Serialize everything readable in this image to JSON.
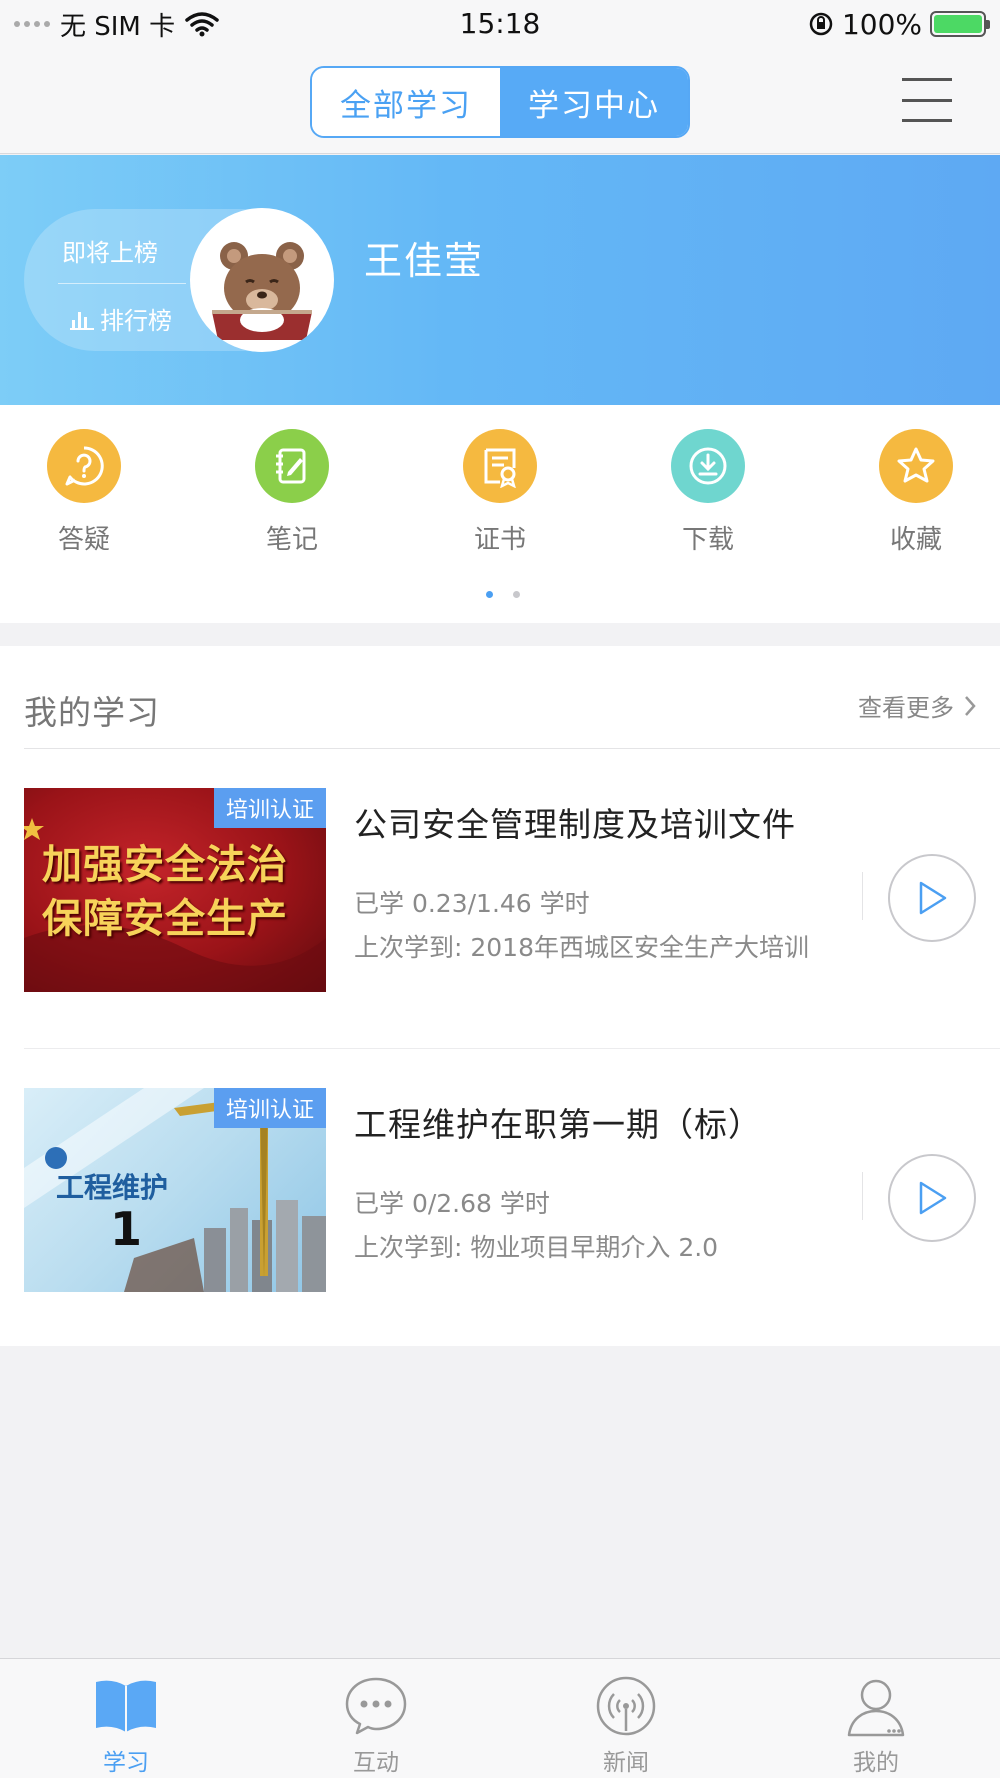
{
  "status_bar": {
    "carrier": "无 SIM 卡",
    "time": "15:18",
    "battery": "100%"
  },
  "header": {
    "tabs": [
      {
        "label": "全部学习",
        "active": false
      },
      {
        "label": "学习中心",
        "active": true
      }
    ],
    "accent": "#57aaf6"
  },
  "profile": {
    "rank_status": "即将上榜",
    "rank_link": "排行榜",
    "name": "王佳莹"
  },
  "quick_actions": [
    {
      "label": "答疑",
      "icon": "question-icon",
      "color": "#f5b940"
    },
    {
      "label": "笔记",
      "icon": "notebook-icon",
      "color": "#8bcf4a"
    },
    {
      "label": "证书",
      "icon": "certificate-icon",
      "color": "#f5b940"
    },
    {
      "label": "下载",
      "icon": "download-icon",
      "color": "#6fd6cf"
    },
    {
      "label": "收藏",
      "icon": "star-icon",
      "color": "#f5b940"
    }
  ],
  "pager": {
    "pages": 2,
    "current": 1
  },
  "my_learning": {
    "title": "我的学习",
    "more_label": "查看更多",
    "courses": [
      {
        "tag": "培训认证",
        "thumb_text_1": "加强安全法治",
        "thumb_text_2": "保障安全生产",
        "title": "公司安全管理制度及培训文件",
        "progress": "已学 0.23/1.46 学时",
        "last": "上次学到: 2018年西城区安全生产大培训"
      },
      {
        "tag": "培训认证",
        "thumb_text_1": "工程维护",
        "thumb_text_2": "1",
        "title": "工程维护在职第一期（标）",
        "progress": "已学 0/2.68 学时",
        "last": "上次学到: 物业项目早期介入 2.0"
      }
    ]
  },
  "tab_bar": [
    {
      "label": "学习",
      "icon": "book-icon",
      "active": true
    },
    {
      "label": "互动",
      "icon": "chat-bubble-icon",
      "active": false
    },
    {
      "label": "新闻",
      "icon": "broadcast-icon",
      "active": false
    },
    {
      "label": "我的",
      "icon": "person-icon",
      "active": false
    }
  ]
}
